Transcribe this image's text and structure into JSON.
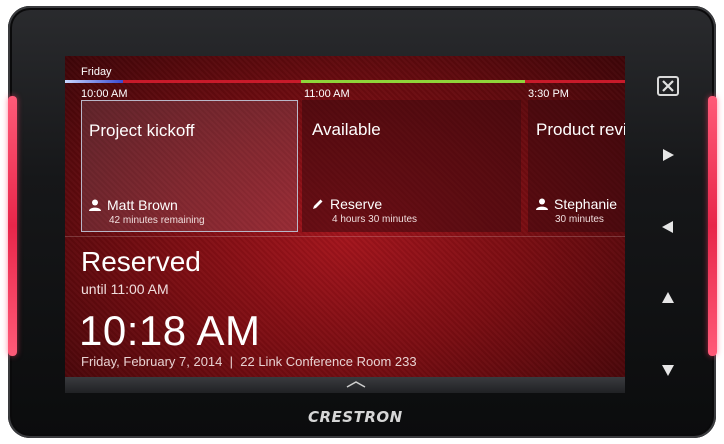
{
  "schedule": {
    "day": "Friday",
    "times": [
      "10:00 AM",
      "11:00 AM",
      "3:30 PM"
    ],
    "cards": [
      {
        "title": "Project kickoff",
        "person": "Matt Brown",
        "sub": "42 minutes remaining",
        "icon": "person-icon",
        "active": true
      },
      {
        "title": "Available",
        "person": "Reserve",
        "sub": "4 hours 30 minutes",
        "icon": "pencil-icon",
        "active": false
      },
      {
        "title": "Product review",
        "person": "Stephanie",
        "sub": "30 minutes",
        "icon": "person-icon",
        "active": false
      }
    ]
  },
  "status": {
    "label": "Reserved",
    "until": "until 11:00 AM"
  },
  "clock": {
    "time": "10:18 AM",
    "date": "Friday, February 7, 2014",
    "separator": "|",
    "room": "22 Link Conference Room 233"
  },
  "buttons": {
    "close_icon": "close-icon",
    "next_icon": "arrow-right-icon",
    "prev_icon": "arrow-left-icon",
    "up_icon": "arrow-up-icon",
    "down_icon": "arrow-down-icon",
    "drawer_icon": "chevron-up-icon"
  },
  "brand": {
    "logo": "CRESTRON"
  },
  "colors": {
    "screen_bg": "#9b121a",
    "timeline_available": "#8fd43a",
    "timeline_busy": "#c81a2a",
    "timeline_now": "#3a4ad0",
    "side_glow": "#e8264a"
  }
}
